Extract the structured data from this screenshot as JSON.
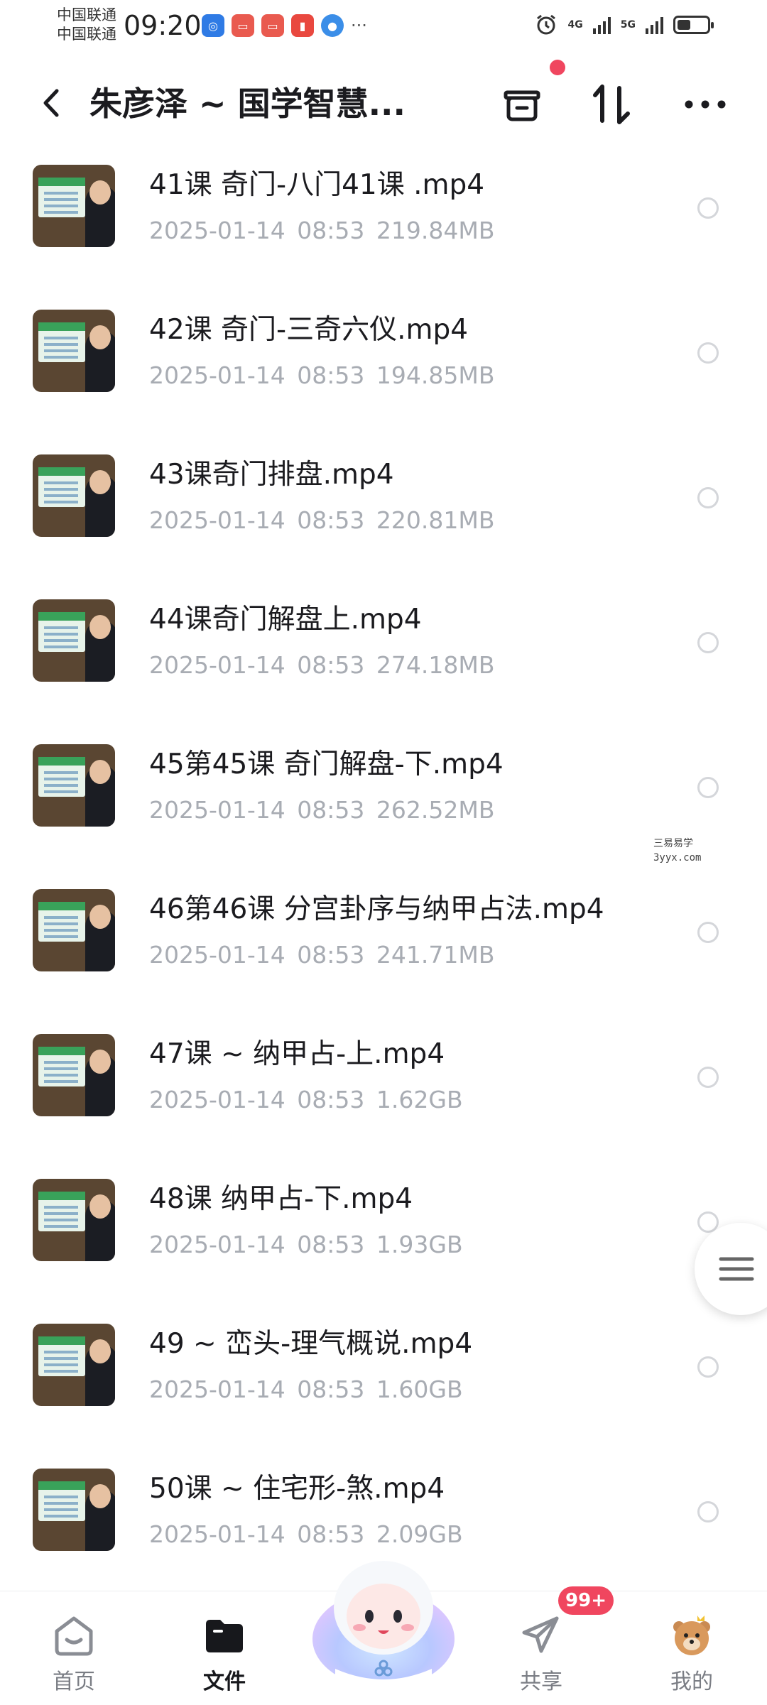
{
  "status_bar": {
    "carrier_1": "中国联通",
    "carrier_2": "中国联通",
    "time": "09:20",
    "more": "···",
    "net_1": "4G",
    "net_2": "5G",
    "battery_level": 0.45
  },
  "header": {
    "title": "朱彦泽 ~ 国学智慧..."
  },
  "files": [
    {
      "name": "41课 奇门-八门41课 .mp4",
      "date": "2025-01-14",
      "time": "08:53",
      "size": "219.84MB"
    },
    {
      "name": "42课 奇门-三奇六仪.mp4",
      "date": "2025-01-14",
      "time": "08:53",
      "size": "194.85MB"
    },
    {
      "name": "43课奇门排盘.mp4",
      "date": "2025-01-14",
      "time": "08:53",
      "size": "220.81MB"
    },
    {
      "name": "44课奇门解盘上.mp4",
      "date": "2025-01-14",
      "time": "08:53",
      "size": "274.18MB"
    },
    {
      "name": "45第45课 奇门解盘-下.mp4",
      "date": "2025-01-14",
      "time": "08:53",
      "size": "262.52MB"
    },
    {
      "name": "46第46课 分宫卦序与纳甲占法.mp4",
      "date": "2025-01-14",
      "time": "08:53",
      "size": "241.71MB"
    },
    {
      "name": "47课 ~ 纳甲占-上.mp4",
      "date": "2025-01-14",
      "time": "08:53",
      "size": "1.62GB"
    },
    {
      "name": "48课 纳甲占-下.mp4",
      "date": "2025-01-14",
      "time": "08:53",
      "size": "1.93GB"
    },
    {
      "name": "49 ~ 峦头-理气概说.mp4",
      "date": "2025-01-14",
      "time": "08:53",
      "size": "1.60GB"
    },
    {
      "name": "50课 ~ 住宅形-煞.mp4",
      "date": "2025-01-14",
      "time": "08:53",
      "size": "2.09GB"
    }
  ],
  "watermark": {
    "line1": "三易易学",
    "line2": "3yyx.com"
  },
  "nav": {
    "home": "首页",
    "files": "文件",
    "share": "共享",
    "mine": "我的",
    "share_badge": "99+"
  },
  "colors": {
    "accent": "#f0465f",
    "meta_text": "#a8acb3",
    "title_text": "#1b1b1f"
  }
}
